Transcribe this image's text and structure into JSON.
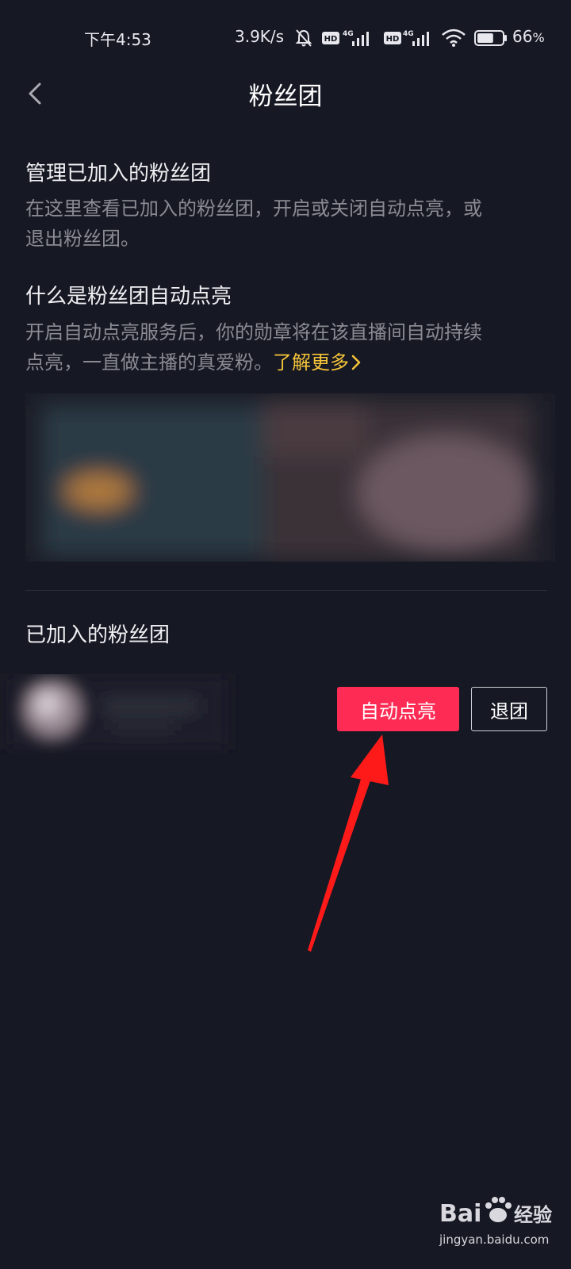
{
  "status_bar": {
    "time": "下午4:53",
    "network_speed": "3.9K/s",
    "battery_percent": "66",
    "battery_unit": "%",
    "battery_level": 0.66,
    "icons": [
      "mute-icon",
      "hd-icon",
      "4g-signal-icon",
      "hd-icon",
      "4g-signal-icon",
      "wifi-icon",
      "battery-icon"
    ]
  },
  "header": {
    "title": "粉丝团",
    "back_icon": "chevron-left-icon"
  },
  "manage": {
    "title": "管理已加入的粉丝团",
    "desc_line1": "在这里查看已加入的粉丝团，开启或关闭自动点亮，或",
    "desc_line2": "退出粉丝团。"
  },
  "what_is": {
    "title": "什么是粉丝团自动点亮",
    "desc_line1": "开启自动点亮服务后，你的勋章将在该直播间自动持续",
    "desc_line2": "点亮，一直做主播的真爱粉。",
    "learn_more": "了解更多",
    "learn_more_icon": "chevron-right-icon"
  },
  "joined": {
    "title": "已加入的粉丝团",
    "items": [
      {
        "auto_light_label": "自动点亮",
        "exit_label": "退团"
      }
    ]
  },
  "colors": {
    "background": "#161823",
    "accent": "#fe2c55",
    "link": "#f6c43a",
    "annotation_arrow": "#ff1a1a"
  },
  "watermark": {
    "brand": "Bai",
    "brand_suffix": "经验",
    "url": "jingyan.baidu.com"
  }
}
